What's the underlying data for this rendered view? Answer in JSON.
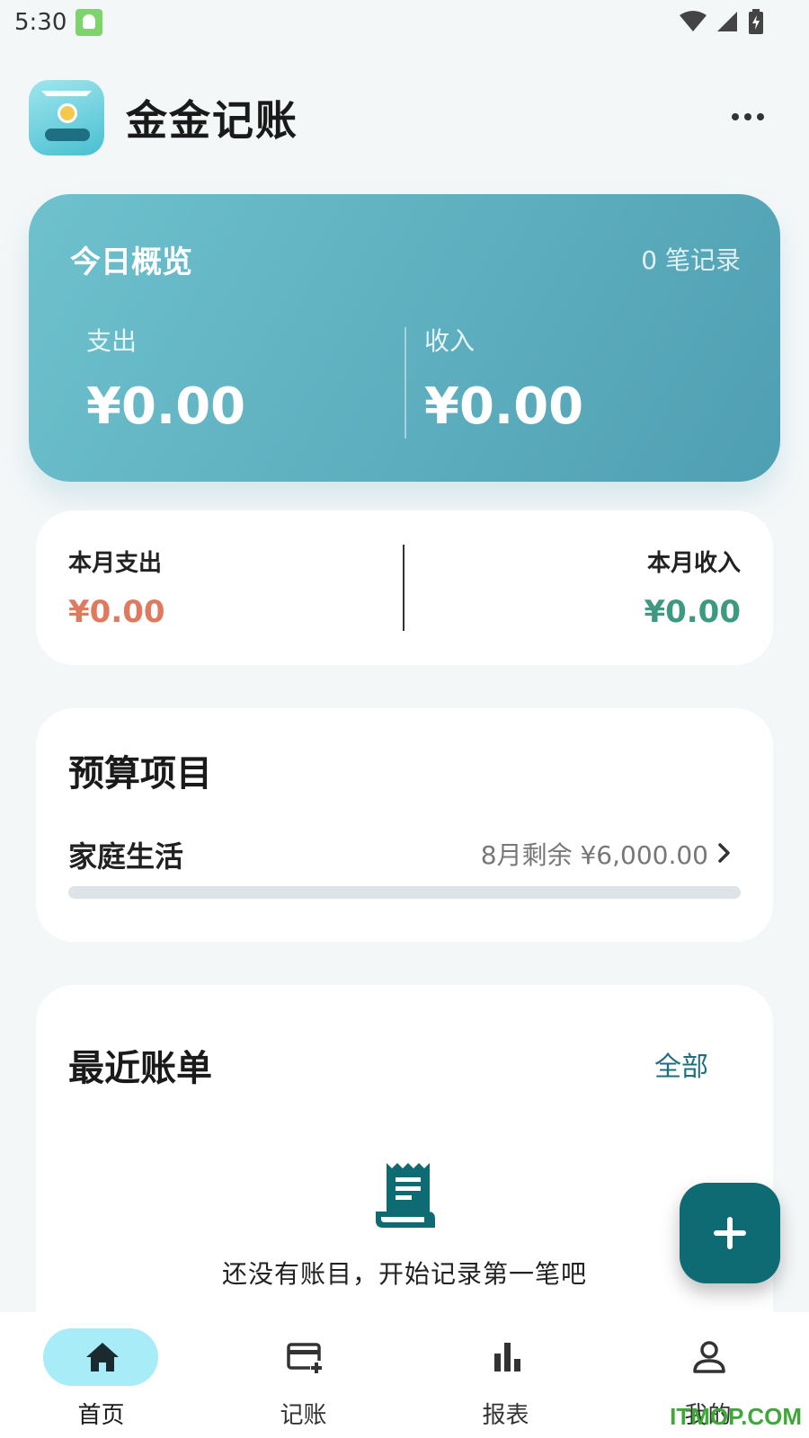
{
  "status_bar": {
    "time": "5:30"
  },
  "header": {
    "app_title": "金金记账"
  },
  "today": {
    "title": "今日概览",
    "record_count": "0 笔记录",
    "expense_label": "支出",
    "expense_amount": "¥0.00",
    "income_label": "收入",
    "income_amount": "¥0.00"
  },
  "month": {
    "expense_label": "本月支出",
    "expense_amount": "¥0.00",
    "income_label": "本月收入",
    "income_amount": "¥0.00",
    "expense_color": "#e07a5f",
    "income_color": "#3c9a80"
  },
  "budget": {
    "heading": "预算项目",
    "items": [
      {
        "name": "家庭生活",
        "remaining": "8月剩余 ¥6,000.00",
        "progress": 0
      }
    ]
  },
  "recent": {
    "heading": "最近账单",
    "all_link": "全部",
    "empty_text": "还没有账目，开始记录第一笔吧"
  },
  "bottom_nav": {
    "items": [
      {
        "label": "首页",
        "icon": "home-icon",
        "active": true
      },
      {
        "label": "记账",
        "icon": "card-add-icon",
        "active": false
      },
      {
        "label": "报表",
        "icon": "bar-chart-icon",
        "active": false
      },
      {
        "label": "我的",
        "icon": "person-icon",
        "active": false
      }
    ]
  },
  "watermark": "ITMOP.COM",
  "colors": {
    "accent": "#0e6a73",
    "card_gradient_start": "#6ec1cd",
    "card_gradient_end": "#4f9fb2"
  }
}
